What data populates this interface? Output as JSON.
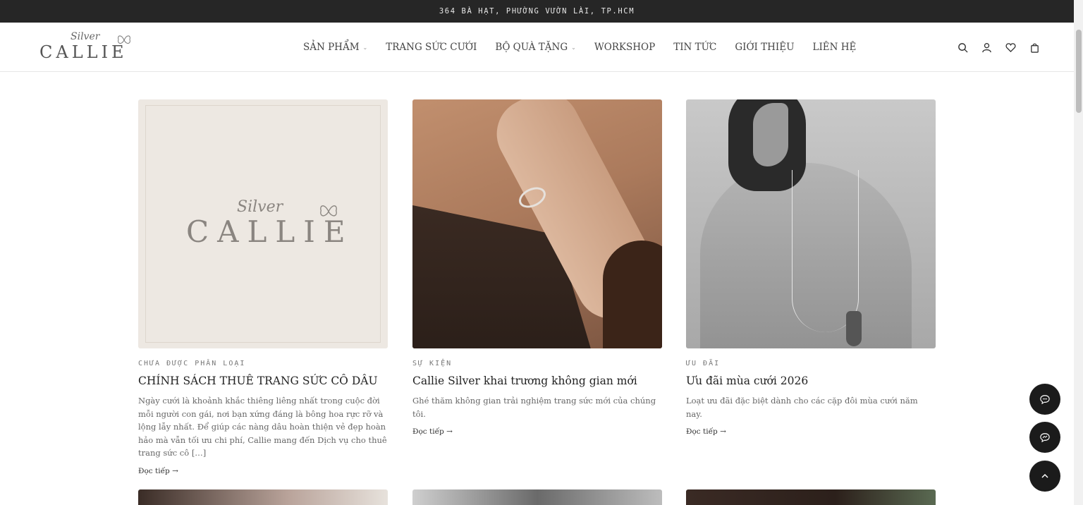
{
  "topbar": {
    "address": "364 BÀ HẠT, PHƯỜNG VƯỜN LÀI, TP.HCM"
  },
  "logo": {
    "script": "Silver",
    "word": "CALLIE"
  },
  "nav": [
    {
      "label": "SẢN PHẨM",
      "has_dropdown": true
    },
    {
      "label": "TRANG SỨC CƯỚI",
      "has_dropdown": false
    },
    {
      "label": "BỘ QUÀ TẶNG",
      "has_dropdown": true
    },
    {
      "label": "WORKSHOP",
      "has_dropdown": false
    },
    {
      "label": "TIN TỨC",
      "has_dropdown": false
    },
    {
      "label": "GIỚI THIỆU",
      "has_dropdown": false
    },
    {
      "label": "LIÊN HỆ",
      "has_dropdown": false
    }
  ],
  "header_icons": [
    "search-icon",
    "account-icon",
    "wishlist-heart-icon",
    "cart-bag-icon"
  ],
  "posts": [
    {
      "category": "CHƯA ĐƯỢC PHÂN LOẠI",
      "title": "CHÍNH SÁCH THUÊ TRANG SỨC CÔ DÂU",
      "excerpt": "Ngày cưới là khoảnh khắc thiêng liêng nhất trong cuộc đời mỗi người con gái, nơi bạn xứng đáng là bông hoa rực rỡ và lộng lẫy nhất. Để giúp các nàng dâu hoàn thiện vẻ đẹp hoàn hảo mà vẫn tối ưu chi phí, Callie mang đến Dịch vụ cho thuê trang sức cô […]",
      "read_more": "Đọc tiếp →",
      "thumb_logo_script": "Silver",
      "thumb_logo_word": "CALLIE"
    },
    {
      "category": "SỰ KIỆN",
      "title": "Callie Silver khai trương không gian mới",
      "excerpt": "Ghé thăm không gian trải nghiệm trang sức mới của chúng tôi.",
      "read_more": "Đọc tiếp →"
    },
    {
      "category": "ƯU ĐÃI",
      "title": "Ưu đãi mùa cưới 2026",
      "excerpt": "Loạt ưu đãi đặc biệt dành cho các cặp đôi mùa cưới năm nay.",
      "read_more": "Đọc tiếp →"
    }
  ],
  "floating_buttons": [
    "chat-icon",
    "messenger-icon",
    "chevron-up-icon"
  ],
  "colors": {
    "topbar_bg": "#262626",
    "fab_bg": "#1b1b1b",
    "thumb_logo_bg": "#ede8e2"
  }
}
